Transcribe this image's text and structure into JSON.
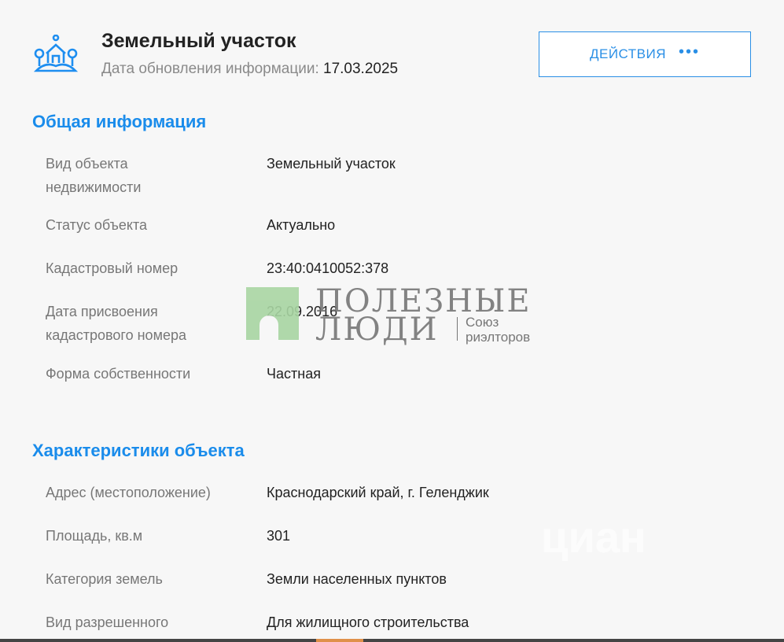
{
  "header": {
    "icon": "land-plot-icon",
    "title": "Земельный участок",
    "updated_label": "Дата обновления информации:",
    "updated_date": "17.03.2025",
    "actions_label": "ДЕЙСТВИЯ",
    "actions_icon": "more-dots-icon"
  },
  "general": {
    "heading": "Общая информация",
    "rows": [
      {
        "label": "Вид объекта недвижимости",
        "value": "Земельный участок"
      },
      {
        "label": "Статус объекта",
        "value": "Актуально"
      },
      {
        "label": "Кадастровый номер",
        "value": "23:40:0410052:378"
      },
      {
        "label": "Дата присвоения кадастрового номера",
        "value": "22.09.2016"
      },
      {
        "label": "Форма собственности",
        "value": "Частная"
      }
    ]
  },
  "characteristics": {
    "heading": "Характеристики объекта",
    "rows": [
      {
        "label": "Адрес (местоположение)",
        "value": "Краснодарский край, г. Геленджик"
      },
      {
        "label": "Площадь, кв.м",
        "value": "301"
      },
      {
        "label": "Категория земель",
        "value": "Земли населенных пунктов"
      },
      {
        "label": "Вид разрешенного",
        "value": "Для жилищного строительства"
      }
    ]
  },
  "watermark": {
    "line1": "ПОЛЕЗНЫЕ",
    "line2": "ЛЮДИ",
    "tag1": "Союз",
    "tag2": "риэлторов",
    "cian": "циан"
  },
  "colors": {
    "accent": "#1a8ceb",
    "label": "#777777",
    "value": "#222222"
  }
}
